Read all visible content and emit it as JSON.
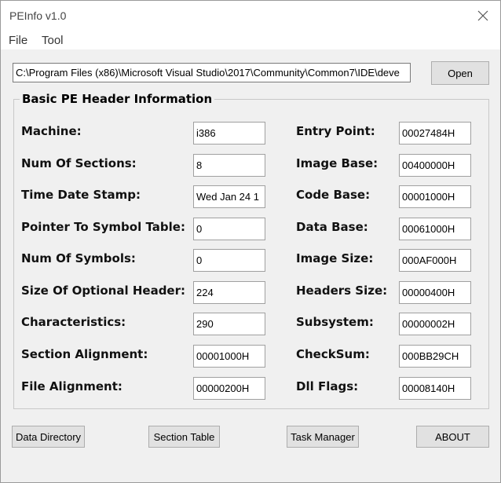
{
  "window": {
    "title": "PEInfo v1.0"
  },
  "menu": {
    "file": "File",
    "tool": "Tool"
  },
  "path": {
    "value": "C:\\Program Files (x86)\\Microsoft Visual Studio\\2017\\Community\\Common7\\IDE\\deve"
  },
  "buttons": {
    "open": "Open",
    "data_directory": "Data Directory",
    "section_table": "Section Table",
    "task_manager": "Task Manager",
    "about": "ABOUT"
  },
  "group": {
    "title": "Basic PE Header Information",
    "left": [
      {
        "label": "Machine:",
        "value": "i386"
      },
      {
        "label": "Num Of Sections:",
        "value": "8"
      },
      {
        "label": "Time Date Stamp:",
        "value": "Wed Jan 24 1"
      },
      {
        "label": "Pointer To Symbol Table:",
        "value": "0"
      },
      {
        "label": "Num Of Symbols:",
        "value": "0"
      },
      {
        "label": "Size Of Optional Header:",
        "value": "224"
      },
      {
        "label": "Characteristics:",
        "value": "290"
      },
      {
        "label": "Section Alignment:",
        "value": "00001000H"
      },
      {
        "label": "File Alignment:",
        "value": "00000200H"
      }
    ],
    "right": [
      {
        "label": "Entry Point:",
        "value": "00027484H"
      },
      {
        "label": "Image Base:",
        "value": "00400000H"
      },
      {
        "label": "Code Base:",
        "value": "00001000H"
      },
      {
        "label": "Data Base:",
        "value": "00061000H"
      },
      {
        "label": "Image Size:",
        "value": "000AF000H"
      },
      {
        "label": "Headers Size:",
        "value": "00000400H"
      },
      {
        "label": "Subsystem:",
        "value": "00000002H"
      },
      {
        "label": "CheckSum:",
        "value": "000BB29CH"
      },
      {
        "label": "Dll Flags:",
        "value": "00008140H"
      }
    ]
  }
}
